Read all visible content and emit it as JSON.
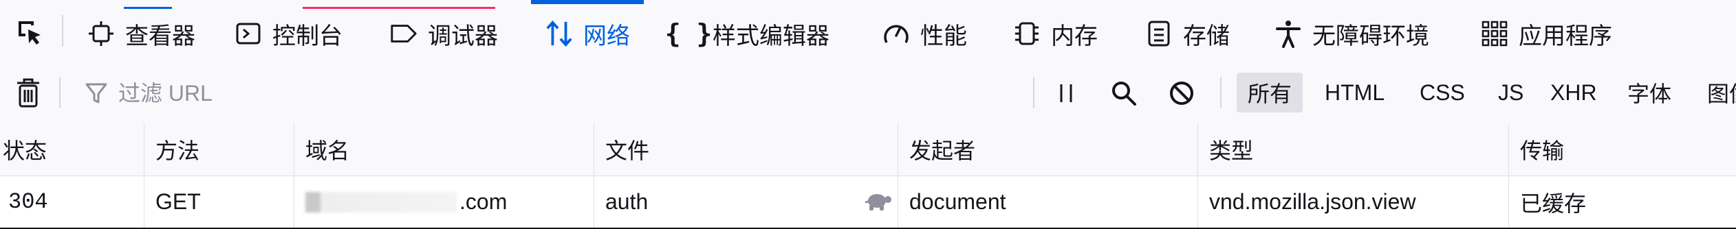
{
  "colors": {
    "accent": "#0061e0",
    "toolbar_bg": "#f9f9fb",
    "border": "#e0e0e6",
    "top_hint_pink": "#ff2a6d",
    "top_hint_blue": "#0061e0"
  },
  "tabs": [
    {
      "label": "查看器",
      "icon": "inspector-icon",
      "active": false
    },
    {
      "label": "控制台",
      "icon": "console-icon",
      "active": false
    },
    {
      "label": "调试器",
      "icon": "debugger-icon",
      "active": false
    },
    {
      "label": "网络",
      "icon": "network-icon",
      "active": true
    },
    {
      "label": "样式编辑器",
      "icon": "style-editor-icon",
      "active": false
    },
    {
      "label": "性能",
      "icon": "performance-icon",
      "active": false
    },
    {
      "label": "内存",
      "icon": "memory-icon",
      "active": false
    },
    {
      "label": "存储",
      "icon": "storage-icon",
      "active": false
    },
    {
      "label": "无障碍环境",
      "icon": "accessibility-icon",
      "active": false
    },
    {
      "label": "应用程序",
      "icon": "application-icon",
      "active": false
    }
  ],
  "toolbar": {
    "filter_placeholder": "过滤 URL",
    "type_filters": [
      "所有",
      "HTML",
      "CSS",
      "JS",
      "XHR",
      "字体",
      "图像"
    ],
    "selected_type": "所有"
  },
  "table": {
    "columns": [
      "状态",
      "方法",
      "域名",
      "文件",
      "发起者",
      "类型",
      "传输"
    ],
    "rows": [
      {
        "status": "304",
        "method": "GET",
        "domain_visible": ".com",
        "file": "auth",
        "initiator": "document",
        "type": "vnd.mozilla.json.view",
        "transferred": "已缓存"
      }
    ]
  }
}
